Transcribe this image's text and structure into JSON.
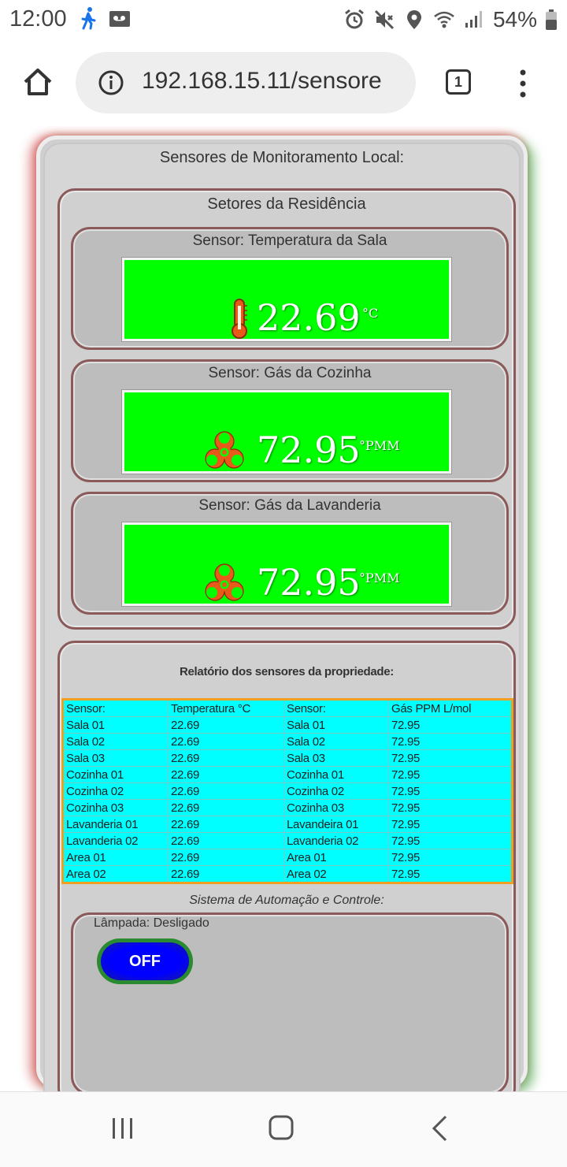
{
  "status_bar": {
    "time": "12:00",
    "battery": "54%",
    "icons": [
      "walk-icon",
      "voicemail-icon",
      "alarm-icon",
      "mute-icon",
      "location-icon",
      "wifi-icon",
      "signal-icon",
      "battery-icon"
    ]
  },
  "browser": {
    "url": "192.168.15.11/sensore",
    "tab_count": "1"
  },
  "page": {
    "title": "Sensores de Monitoramento Local:",
    "sectors_title": "Setores da Residência",
    "sensors": [
      {
        "title": "Sensor: Temperatura da Sala",
        "value": "22.69",
        "unit": "°C",
        "icon": "thermometer-icon"
      },
      {
        "title": "Sensor: Gás da Cozinha",
        "value": "72.95",
        "unit": "°PMM",
        "icon": "biohazard-icon"
      },
      {
        "title": "Sensor: Gás da Lavanderia",
        "value": "72.95",
        "unit": "°PMM",
        "icon": "biohazard-icon"
      }
    ],
    "report": {
      "title": "Relatório dos sensores da propriedade:",
      "headers": [
        "Sensor:",
        "Temperatura °C",
        "Sensor:",
        "Gás PPM L/mol"
      ],
      "rows": [
        [
          "Sala 01",
          "22.69",
          "Sala 01",
          "72.95"
        ],
        [
          "Sala 02",
          "22.69",
          "Sala 02",
          "72.95"
        ],
        [
          "Sala 03",
          "22.69",
          "Sala 03",
          "72.95"
        ],
        [
          "Cozinha 01",
          "22.69",
          "Cozinha 01",
          "72.95"
        ],
        [
          "Cozinha 02",
          "22.69",
          "Cozinha 02",
          "72.95"
        ],
        [
          "Cozinha 03",
          "22.69",
          "Cozinha 03",
          "72.95"
        ],
        [
          "Lavanderia 01",
          "22.69",
          "Lavandeira 01",
          "72.95"
        ],
        [
          "Lavanderia 02",
          "22.69",
          "Lavanderia 02",
          "72.95"
        ],
        [
          "Area 01",
          "22.69",
          "Area 01",
          "72.95"
        ],
        [
          "Area 02",
          "22.69",
          "Area 02",
          "72.95"
        ]
      ]
    },
    "automation": {
      "title": "Sistema de Automação e Controle:",
      "lamp_label": "Lâmpada: Desligado",
      "button_label": "OFF"
    }
  },
  "colors": {
    "sensor_ok": "#00ff00",
    "table_bg": "#00ffff",
    "table_border": "#f0a020",
    "button_blue": "#0000ff",
    "button_ring": "#2a8a30"
  }
}
